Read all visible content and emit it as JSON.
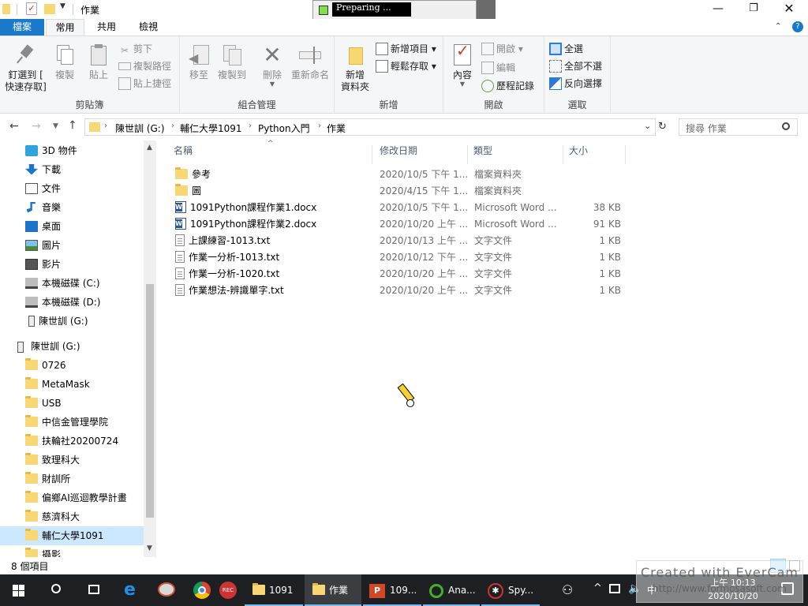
{
  "window": {
    "title": "作業",
    "recorder_status": "Preparing ..."
  },
  "ribbon_tabs": {
    "file": "檔案",
    "home": "常用",
    "share": "共用",
    "view": "檢視"
  },
  "ribbon": {
    "clipboard": {
      "pin_line1": "釘選到 [",
      "pin_line2": "快速存取]",
      "copy": "複製",
      "paste": "貼上",
      "cut": "剪下",
      "copy_path": "複製路徑",
      "paste_shortcut": "貼上捷徑",
      "label": "剪貼簿"
    },
    "organize": {
      "move_to": "移至",
      "copy_to": "複製到",
      "delete": "刪除",
      "rename": "重新命名",
      "label": "組合管理"
    },
    "new": {
      "new_folder_line1": "新增",
      "new_folder_line2": "資料夾",
      "new_item": "新增項目",
      "easy_access": "輕鬆存取",
      "label": "新增"
    },
    "open": {
      "properties": "內容",
      "open": "開啟",
      "edit": "編輯",
      "history": "歷程記錄",
      "label": "開啟"
    },
    "select": {
      "select_all": "全選",
      "select_none": "全部不選",
      "invert": "反向選擇",
      "label": "選取"
    }
  },
  "address": {
    "crumbs": [
      "陳世訓 (G:)",
      "輔仁大學1091",
      "Python入門",
      "作業"
    ],
    "search_placeholder": "搜尋 作業"
  },
  "nav": {
    "items": [
      {
        "label": "3D 物件",
        "icon": "3d-objects-icon"
      },
      {
        "label": "下載",
        "icon": "download-icon"
      },
      {
        "label": "文件",
        "icon": "documents-icon"
      },
      {
        "label": "音樂",
        "icon": "music-icon"
      },
      {
        "label": "桌面",
        "icon": "desktop-icon"
      },
      {
        "label": "圖片",
        "icon": "pictures-icon"
      },
      {
        "label": "影片",
        "icon": "videos-icon"
      },
      {
        "label": "本機磁碟 (C:)",
        "icon": "drive-icon"
      },
      {
        "label": "本機磁碟 (D:)",
        "icon": "drive-icon"
      },
      {
        "label": "陳世訓 (G:)",
        "icon": "usb-drive-icon"
      }
    ],
    "drive_root": "陳世訓 (G:)",
    "folders": [
      "0726",
      "MetaMask",
      "USB",
      "中信金管理學院",
      "扶輪社20200724",
      "致理科大",
      "財訓所",
      "偏鄉AI巡迴教學計畫",
      "慈濟科大",
      "輔仁大學1091",
      "攝影"
    ]
  },
  "columns": {
    "name": "名稱",
    "modified": "修改日期",
    "type": "類型",
    "size": "大小"
  },
  "files": [
    {
      "name": "參考",
      "modified": "2020/10/5 下午 1...",
      "type": "檔案資料夾",
      "size": "",
      "kind": "folder"
    },
    {
      "name": "圖",
      "modified": "2020/4/15 下午 1...",
      "type": "檔案資料夾",
      "size": "",
      "kind": "folder"
    },
    {
      "name": "1091Python課程作業1.docx",
      "modified": "2020/10/5 下午 1...",
      "type": "Microsoft Word ...",
      "size": "38 KB",
      "kind": "word"
    },
    {
      "name": "1091Python課程作業2.docx",
      "modified": "2020/10/20 上午 ...",
      "type": "Microsoft Word ...",
      "size": "91 KB",
      "kind": "word"
    },
    {
      "name": "上課練習-1013.txt",
      "modified": "2020/10/13 上午 ...",
      "type": "文字文件",
      "size": "1 KB",
      "kind": "txt"
    },
    {
      "name": "作業一分析-1013.txt",
      "modified": "2020/10/12 下午 ...",
      "type": "文字文件",
      "size": "1 KB",
      "kind": "txt"
    },
    {
      "name": "作業一分析-1020.txt",
      "modified": "2020/10/20 上午 ...",
      "type": "文字文件",
      "size": "1 KB",
      "kind": "txt"
    },
    {
      "name": "作業想法-辨識單字.txt",
      "modified": "2020/10/20 上午 ...",
      "type": "文字文件",
      "size": "1 KB",
      "kind": "txt"
    }
  ],
  "status": {
    "item_count": "8 個項目"
  },
  "taskbar": {
    "apps": [
      {
        "label": "1091"
      },
      {
        "label": "作業"
      },
      {
        "label": "109..."
      },
      {
        "label": "Ana..."
      },
      {
        "label": "Spy..."
      }
    ],
    "time": "上午 10:13",
    "date": "2020/10/20"
  },
  "watermark": {
    "line1": "Created with EverCam",
    "line2": "http://www.formosasoft.com"
  },
  "colors": {
    "file_tab": "#1979ca",
    "ribbon_bg": "#f5f6f7",
    "taskbar": "#1d1f22",
    "selection": "#cce8ff",
    "folder": "#f8d775"
  }
}
